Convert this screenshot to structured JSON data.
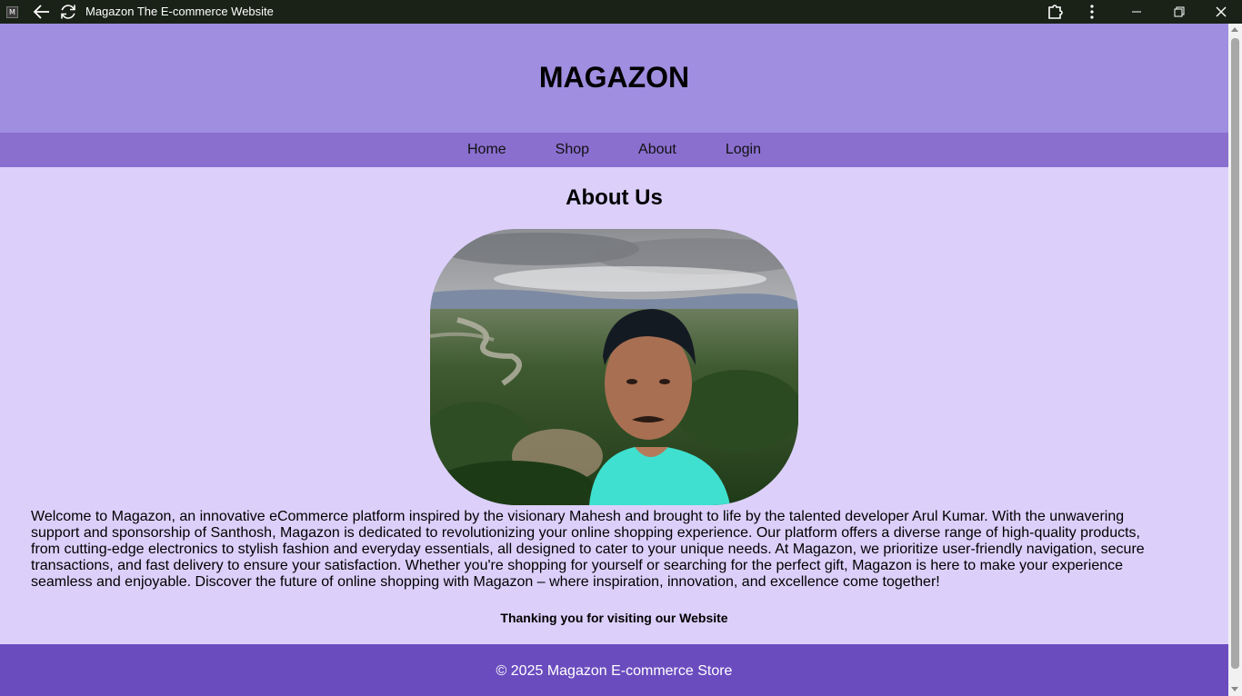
{
  "browser": {
    "favicon_letter": "M",
    "tab_title": "Magazon The E-commerce Website",
    "icons": [
      "back-arrow-icon",
      "reload-icon",
      "extensions-icon",
      "kebab-menu-icon",
      "minimize-icon",
      "restore-icon",
      "close-icon"
    ]
  },
  "header": {
    "title": "MAGAZON"
  },
  "nav": {
    "items": [
      {
        "label": "Home"
      },
      {
        "label": "Shop"
      },
      {
        "label": "About"
      },
      {
        "label": "Login"
      }
    ]
  },
  "about": {
    "heading": "About Us",
    "text": "Welcome to Magazon, an innovative eCommerce platform inspired by the visionary Mahesh and brought to life by the talented developer Arul Kumar. With the unwavering support and sponsorship of Santhosh, Magazon is dedicated to revolutionizing your online shopping experience. Our platform offers a diverse range of high-quality products, from cutting-edge electronics to stylish fashion and everyday essentials, all designed to cater to your unique needs. At Magazon, we prioritize user-friendly navigation, secure transactions, and fast delivery to ensure your satisfaction. Whether you're shopping for yourself or searching for the perfect gift, Magazon is here to make your experience seamless and enjoyable. Discover the future of online shopping with Magazon – where inspiration, innovation, and excellence come together!",
    "thanks": "Thanking you for visiting our Website"
  },
  "footer": {
    "text": "© 2025 Magazon E-commerce Store"
  },
  "colors": {
    "titlebar": "#1a2217",
    "header_bg": "#a08ee0",
    "nav_bg": "#8a6fcf",
    "page_bg": "#dcd0fb",
    "footer_bg": "#6b4cbf"
  }
}
